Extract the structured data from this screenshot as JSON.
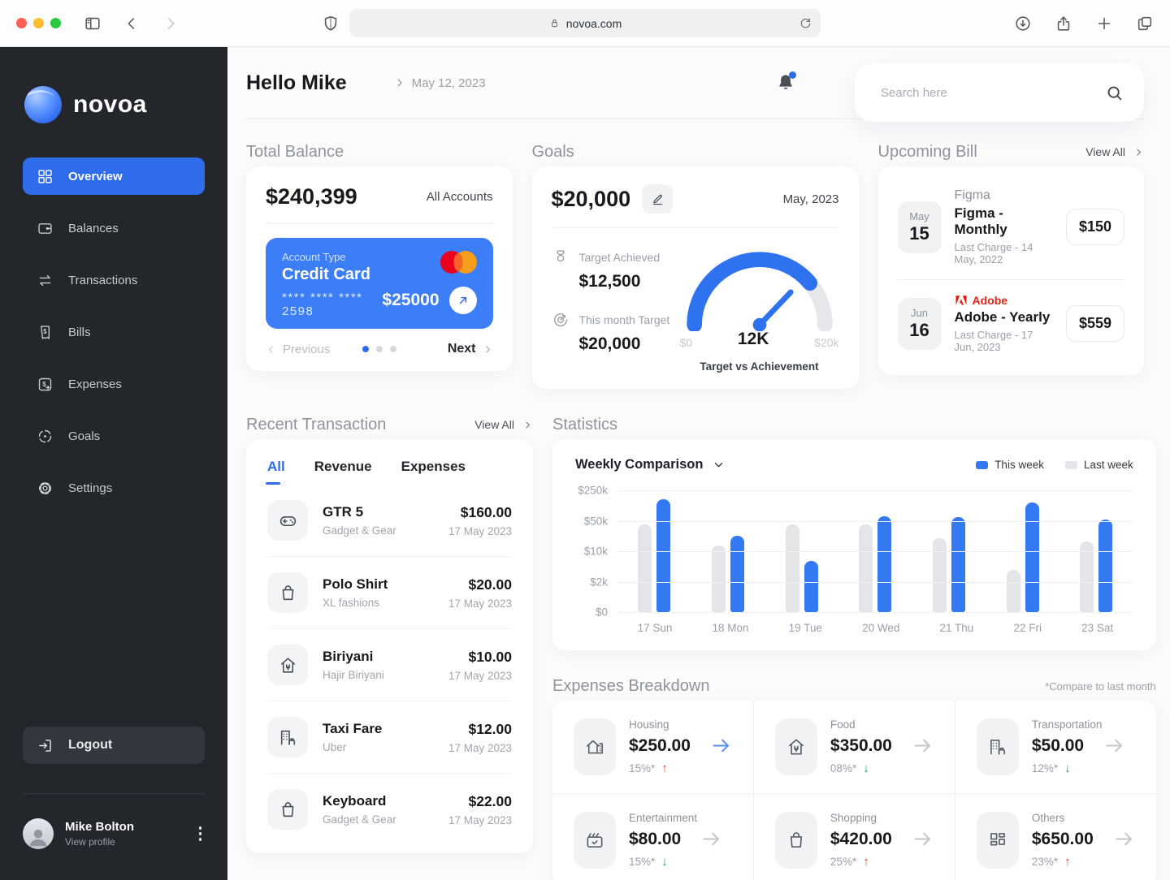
{
  "browser": {
    "url": "novoa.com"
  },
  "colors": {
    "accent": "#2E6CEB",
    "card_blue": "#3B7EF7",
    "chart_this_week": "#3478F2",
    "chart_last_week": "#E3E5E8",
    "positive_green": "#23A454",
    "negative_red": "#E2452E",
    "adobe_red": "#EB1000",
    "mastercard_red": "#EB001B",
    "mastercard_orange": "#F79E1B",
    "notification_dot": "#2E6CEB",
    "sidebar_bg": "#23262B"
  },
  "sidebar": {
    "brand": "novoa",
    "items": [
      {
        "label": "Overview",
        "icon": "grid",
        "active": true
      },
      {
        "label": "Balances",
        "icon": "wallet",
        "active": false
      },
      {
        "label": "Transactions",
        "icon": "transfer",
        "active": false
      },
      {
        "label": "Bills",
        "icon": "bills",
        "active": false
      },
      {
        "label": "Expenses",
        "icon": "expenses",
        "active": false
      },
      {
        "label": "Goals",
        "icon": "goals",
        "active": false
      },
      {
        "label": "Settings",
        "icon": "settings",
        "active": false
      }
    ],
    "logout_label": "Logout",
    "profile": {
      "name": "Mike Bolton",
      "sub": "View profile"
    }
  },
  "header": {
    "greeting": "Hello Mike",
    "date": "May 12, 2023",
    "search_placeholder": "Search here"
  },
  "total_balance": {
    "title": "Total Balance",
    "amount": "$240,399",
    "accounts_label": "All Accounts",
    "card": {
      "type_label": "Account Type",
      "type": "Credit Card",
      "number": "**** **** **** 2598",
      "amount": "$25000"
    },
    "prev_label": "Previous",
    "next_label": "Next",
    "page_count": 3,
    "active_page": 0
  },
  "goals": {
    "title": "Goals",
    "amount": "$20,000",
    "month": "May, 2023",
    "achieved_label": "Target Achieved",
    "achieved": "$12,500",
    "target_label": "This month Target",
    "target": "$20,000",
    "gauge": {
      "min": "$0",
      "value": "12K",
      "max": "$20k",
      "caption": "Target vs Achievement",
      "percent_filled": 78
    }
  },
  "upcoming_bill": {
    "title": "Upcoming Bill",
    "view_all": "View All",
    "items": [
      {
        "month": "May",
        "day": "15",
        "brand": "Figma",
        "brand_style": "plain",
        "name": "Figma - Monthly",
        "last": "Last Charge - 14 May, 2022",
        "price": "$150"
      },
      {
        "month": "Jun",
        "day": "16",
        "brand": "Adobe",
        "brand_style": "adobe",
        "name": "Adobe - Yearly",
        "last": "Last Charge - 17 Jun, 2023",
        "price": "$559"
      }
    ]
  },
  "transactions": {
    "title": "Recent Transaction",
    "view_all": "View All",
    "tabs": [
      "All",
      "Revenue",
      "Expenses"
    ],
    "active_tab": "All",
    "items": [
      {
        "icon": "gamepad",
        "name": "GTR 5",
        "category": "Gadget & Gear",
        "amount": "$160.00",
        "date": "17 May 2023"
      },
      {
        "icon": "bag",
        "name": "Polo Shirt",
        "category": "XL fashions",
        "amount": "$20.00",
        "date": "17 May 2023"
      },
      {
        "icon": "food",
        "name": "Biriyani",
        "category": "Hajir Biriyani",
        "amount": "$10.00",
        "date": "17 May 2023"
      },
      {
        "icon": "taxi",
        "name": "Taxi Fare",
        "category": "Uber",
        "amount": "$12.00",
        "date": "17 May 2023"
      },
      {
        "icon": "bag",
        "name": "Keyboard",
        "category": "Gadget & Gear",
        "amount": "$22.00",
        "date": "17 May 2023"
      }
    ]
  },
  "statistics": {
    "title": "Statistics",
    "dropdown_label": "Weekly Comparison"
  },
  "chart_data": {
    "type": "bar",
    "title": "Weekly Comparison",
    "categories": [
      "17 Sun",
      "18 Mon",
      "19 Tue",
      "20 Wed",
      "21 Thu",
      "22 Fri",
      "23 Sat"
    ],
    "series": [
      {
        "name": "Last week",
        "color": "#E3E5E8",
        "values": [
          45000,
          15000,
          45000,
          45000,
          22000,
          4500,
          18000
        ],
        "heights_pct": [
          72,
          55,
          72,
          72,
          61,
          35,
          58
        ]
      },
      {
        "name": "This week",
        "color": "#3478F2",
        "values": [
          190000,
          28000,
          7000,
          62000,
          58000,
          160000,
          52000
        ],
        "heights_pct": [
          93,
          63,
          42,
          79,
          78,
          90,
          76
        ]
      }
    ],
    "y_ticks": [
      "$250k",
      "$50k",
      "$10k",
      "$2k",
      "$0"
    ],
    "y_scale": "log-like (each gridline ~5x previous)",
    "legend_position": "top-right",
    "grid": true
  },
  "expenses_breakdown": {
    "title": "Expenses Breakdown",
    "note": "*Compare to last month",
    "items": [
      {
        "icon": "house",
        "label": "Housing",
        "amount": "$250.00",
        "percent": "15%*",
        "trend": "up",
        "arrow": "blue"
      },
      {
        "icon": "food",
        "label": "Food",
        "amount": "$350.00",
        "percent": "08%*",
        "trend": "down",
        "arrow": "gray"
      },
      {
        "icon": "taxi",
        "label": "Transportation",
        "amount": "$50.00",
        "percent": "12%*",
        "trend": "down",
        "arrow": "gray"
      },
      {
        "icon": "clapper",
        "label": "Entertainment",
        "amount": "$80.00",
        "percent": "15%*",
        "trend": "down",
        "arrow": "gray"
      },
      {
        "icon": "bag",
        "label": "Shopping",
        "amount": "$420.00",
        "percent": "25%*",
        "trend": "up",
        "arrow": "gray"
      },
      {
        "icon": "gridsm",
        "label": "Others",
        "amount": "$650.00",
        "percent": "23%*",
        "trend": "up",
        "arrow": "gray"
      }
    ]
  }
}
